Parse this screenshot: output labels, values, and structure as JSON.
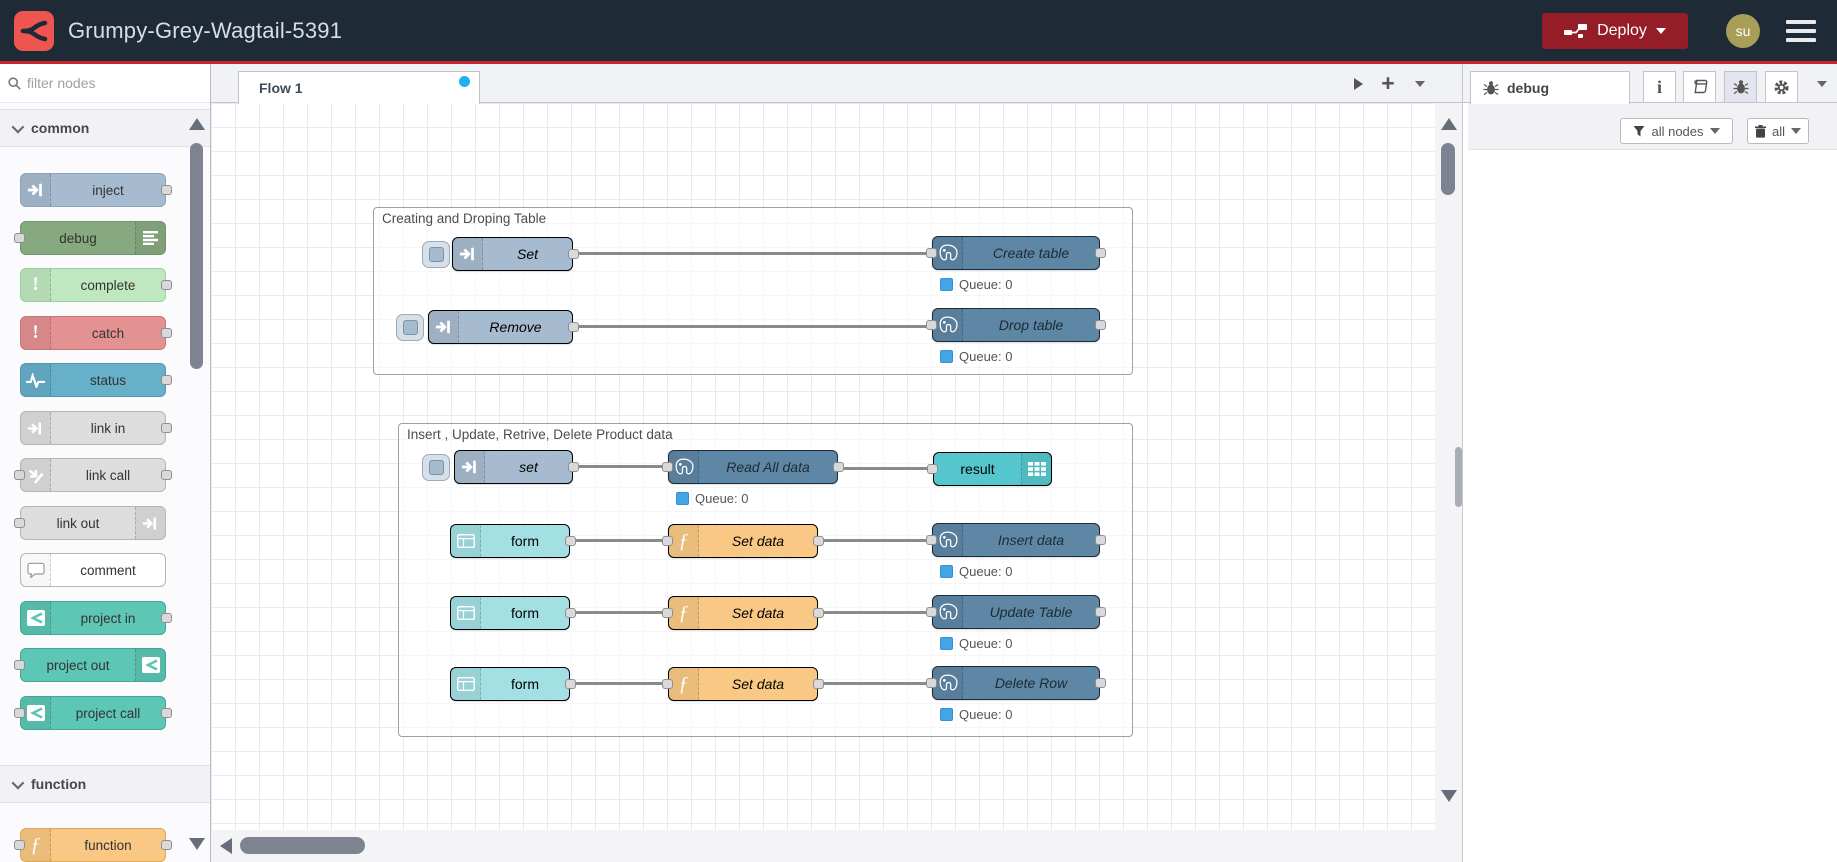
{
  "header": {
    "title": "Grumpy-Grey-Wagtail-5391",
    "deploy_label": "Deploy",
    "avatar": "su"
  },
  "palette": {
    "filter_placeholder": "filter nodes",
    "categories": [
      {
        "label": "common",
        "items": [
          {
            "label": "inject"
          },
          {
            "label": "debug"
          },
          {
            "label": "complete"
          },
          {
            "label": "catch"
          },
          {
            "label": "status"
          },
          {
            "label": "link in"
          },
          {
            "label": "link call"
          },
          {
            "label": "link out"
          },
          {
            "label": "comment"
          },
          {
            "label": "project in"
          },
          {
            "label": "project out"
          },
          {
            "label": "project call"
          }
        ]
      },
      {
        "label": "function",
        "items": [
          {
            "label": "function"
          }
        ]
      }
    ]
  },
  "workspace": {
    "tab": "Flow 1"
  },
  "flow": {
    "groups": [
      {
        "label": "Creating and Droping Table"
      },
      {
        "label": "Insert , Update, Retrive, Delete Product data"
      }
    ],
    "nodes": {
      "set1": "Set",
      "create_table": "Create table",
      "remove": "Remove",
      "drop_table": "Drop table",
      "set2": "set",
      "read_all": "Read All data",
      "result": "result",
      "form": "form",
      "set_data": "Set data",
      "insert_data": "Insert data",
      "update_table": "Update Table",
      "delete_row": "Delete Row"
    },
    "status_label": "Queue: 0"
  },
  "sidebar": {
    "tab": "debug",
    "filter_button": "all nodes",
    "clear_button": "all"
  },
  "colors": {
    "header_bg": "#1f2a37",
    "accent_red": "#c8262b",
    "deploy_red": "#941d28",
    "inject": "#a6bbcf",
    "debug": "#87a980",
    "complete": "#c0e8c0",
    "catch": "#e49191",
    "status": "#66b0c9",
    "link": "#dddddd",
    "project": "#5dc6b4",
    "function": "#f9c884",
    "postgres": "#5e86a5",
    "form": "#a2e0e4",
    "table": "#55c6cd",
    "status_dot": "#42a5e5",
    "tab_dot": "#1fb0f2"
  }
}
